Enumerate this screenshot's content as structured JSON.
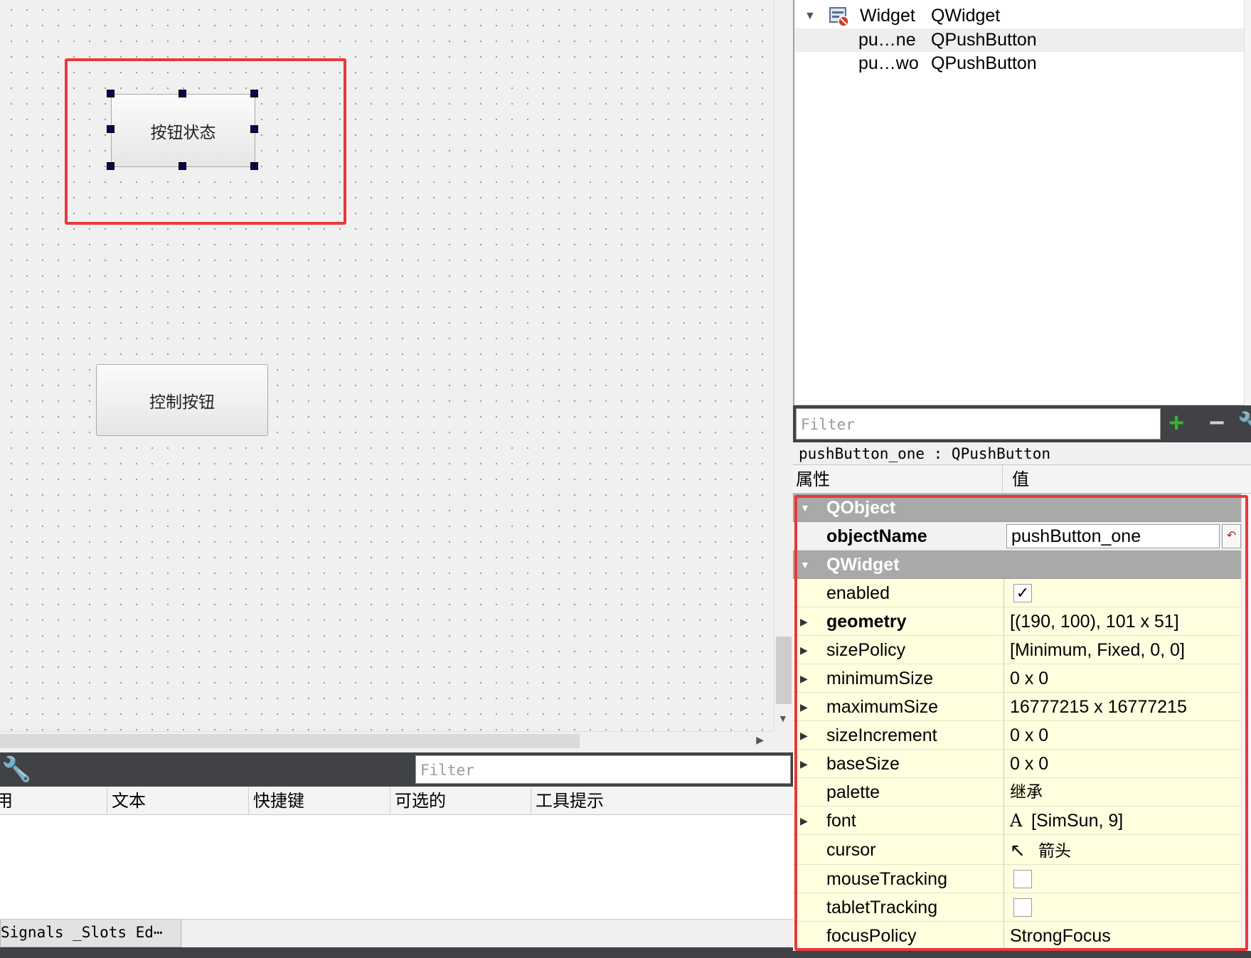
{
  "canvas": {
    "button_state": "按钮状态",
    "button_control": "控制按钮"
  },
  "action_editor": {
    "filter_placeholder": "Filter",
    "columns": [
      "用",
      "文本",
      "快捷键",
      "可选的",
      "工具提示"
    ],
    "tab_label": "Signals _Slots Ed⋯"
  },
  "object_tree": {
    "rows": [
      {
        "name": "Widget",
        "class": "QWidget"
      },
      {
        "name": "pu…ne",
        "class": "QPushButton"
      },
      {
        "name": "pu…wo",
        "class": "QPushButton"
      }
    ]
  },
  "property_editor": {
    "filter_placeholder": "Filter",
    "current_object": "pushButton_one : QPushButton",
    "header": {
      "property": "属性",
      "value": "值"
    },
    "groups": {
      "qobject": "QObject",
      "qwidget": "QWidget"
    },
    "rows": {
      "objectName": {
        "name": "objectName",
        "value": "pushButton_one"
      },
      "enabled": {
        "name": "enabled",
        "checked": true
      },
      "geometry": {
        "name": "geometry",
        "value": "[(190, 100), 101 x 51]"
      },
      "sizePolicy": {
        "name": "sizePolicy",
        "value": "[Minimum, Fixed, 0, 0]"
      },
      "minimumSize": {
        "name": "minimumSize",
        "value": "0 x 0"
      },
      "maximumSize": {
        "name": "maximumSize",
        "value": "16777215 x 16777215"
      },
      "sizeIncrement": {
        "name": "sizeIncrement",
        "value": "0 x 0"
      },
      "baseSize": {
        "name": "baseSize",
        "value": "0 x 0"
      },
      "palette": {
        "name": "palette",
        "value": "继承"
      },
      "font": {
        "name": "font",
        "value": "[SimSun, 9]"
      },
      "cursor": {
        "name": "cursor",
        "value": "箭头"
      },
      "mouseTracking": {
        "name": "mouseTracking",
        "checked": false
      },
      "tabletTracking": {
        "name": "tabletTracking",
        "checked": false
      },
      "focusPolicy": {
        "name": "focusPolicy",
        "value": "StrongFocus"
      }
    }
  },
  "colors": {
    "highlight_box": "#e8383d",
    "property_background": "#ffffe0",
    "group_header": "#a9a9a9",
    "dark_toolbar": "#404246"
  }
}
